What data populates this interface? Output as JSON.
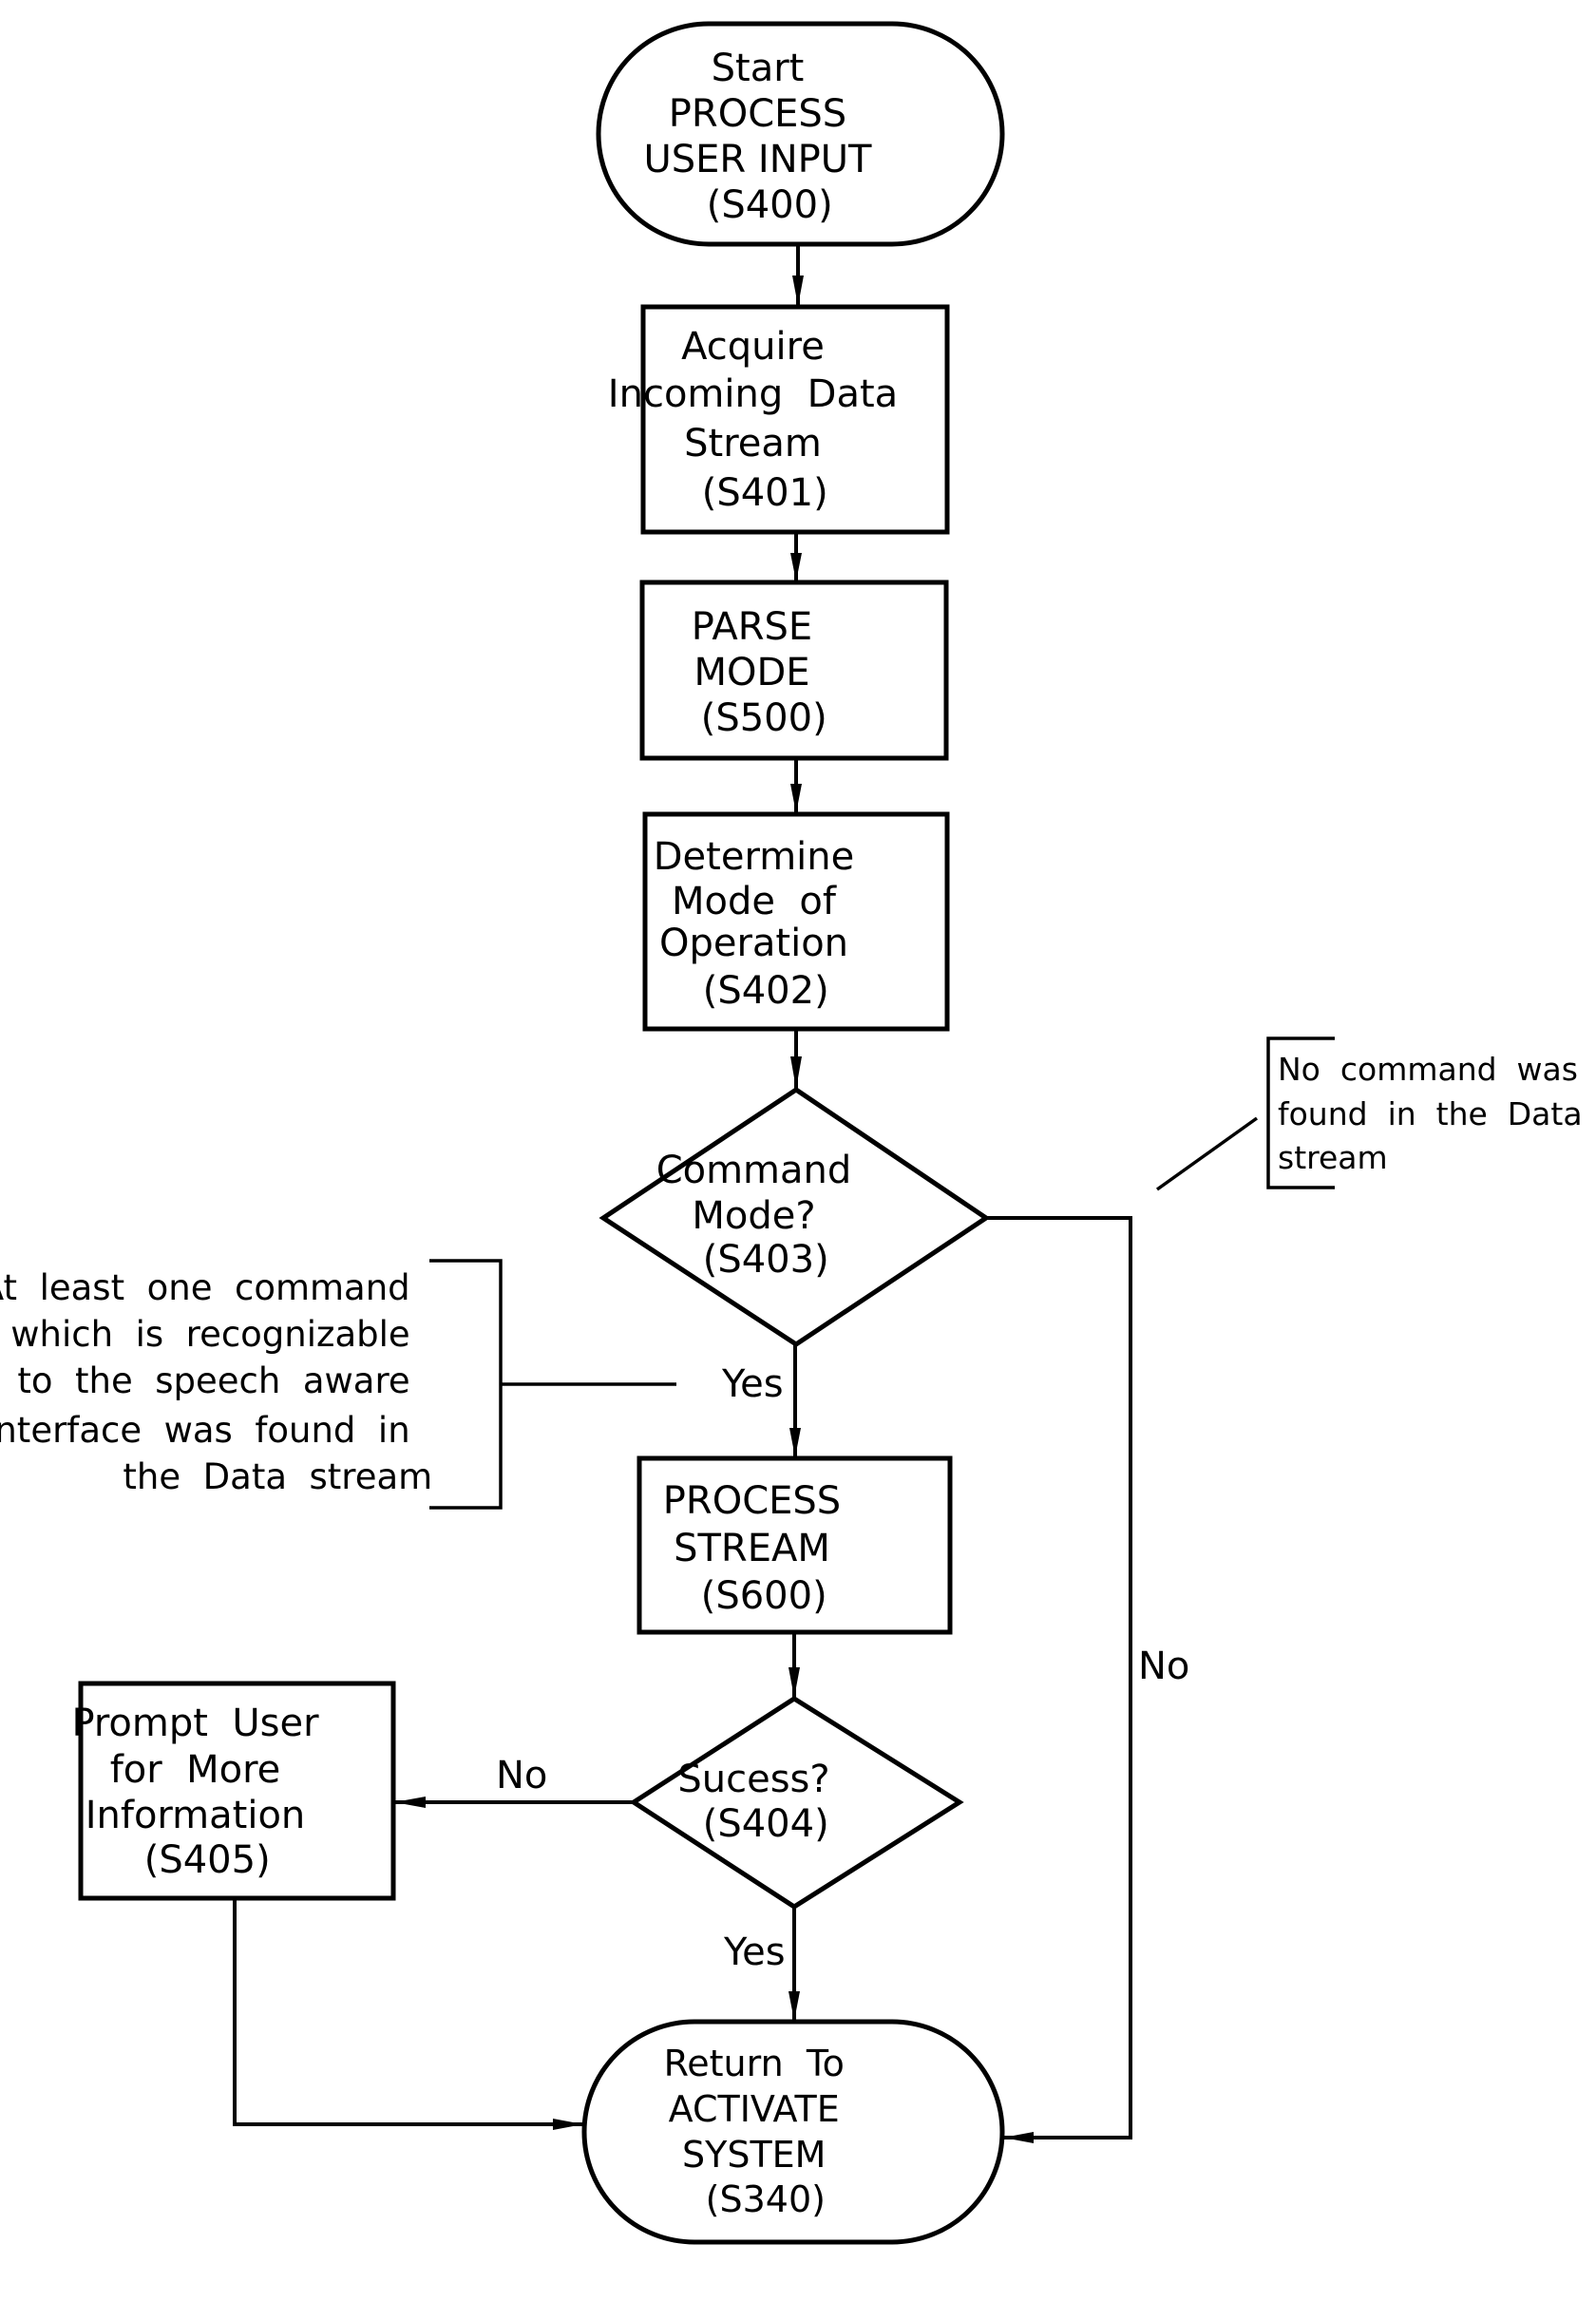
{
  "figure": {
    "type": "flowchart",
    "colors": {
      "stroke": "#000000",
      "background": "#ffffff",
      "text": "#000000"
    }
  },
  "nodes": {
    "s400": {
      "id": "S400",
      "shape": "terminal",
      "lines": [
        "Start",
        "PROCESS",
        "USER INPUT",
        "(S400)"
      ]
    },
    "s401": {
      "id": "S401",
      "shape": "process",
      "lines": [
        "Acquire",
        "Incoming  Data",
        "Stream",
        "(S401)"
      ]
    },
    "s500": {
      "id": "S500",
      "shape": "process",
      "lines": [
        "PARSE",
        "MODE",
        "(S500)"
      ]
    },
    "s402": {
      "id": "S402",
      "shape": "process",
      "lines": [
        "Determine",
        "Mode  of",
        "Operation",
        "(S402)"
      ]
    },
    "s403": {
      "id": "S403",
      "shape": "decision",
      "lines": [
        "Command",
        "Mode?",
        "(S403)"
      ]
    },
    "s600": {
      "id": "S600",
      "shape": "process",
      "lines": [
        "PROCESS",
        "STREAM",
        "(S600)"
      ]
    },
    "s404": {
      "id": "S404",
      "shape": "decision",
      "lines": [
        "Sucess?",
        "(S404)"
      ]
    },
    "s405": {
      "id": "S405",
      "shape": "process",
      "lines": [
        "Prompt  User",
        "for  More",
        "Information",
        "(S405)"
      ]
    },
    "s340": {
      "id": "S340",
      "shape": "terminal",
      "lines": [
        "Return  To",
        "ACTIVATE",
        "SYSTEM",
        "(S340)"
      ]
    }
  },
  "edges": [
    {
      "from": "S400",
      "to": "S401",
      "label": ""
    },
    {
      "from": "S401",
      "to": "S500",
      "label": ""
    },
    {
      "from": "S500",
      "to": "S402",
      "label": ""
    },
    {
      "from": "S402",
      "to": "S403",
      "label": ""
    },
    {
      "from": "S403",
      "to": "S600",
      "label": "Yes"
    },
    {
      "from": "S403",
      "to": "S340",
      "label": "No"
    },
    {
      "from": "S600",
      "to": "S404",
      "label": ""
    },
    {
      "from": "S404",
      "to": "S405",
      "label": "No"
    },
    {
      "from": "S404",
      "to": "S340",
      "label": "Yes"
    },
    {
      "from": "S405",
      "to": "S340",
      "label": ""
    }
  ],
  "edge_labels": {
    "s403_yes": "Yes",
    "s403_no": "No",
    "s404_no": "No",
    "s404_yes": "Yes"
  },
  "annotations": {
    "yes_note": {
      "attached_to": "S403 Yes",
      "lines": [
        "At  least  one  command",
        "which  is  recognizable",
        "to  the  speech  aware",
        "interface  was  found  in",
        "the  Data  stream"
      ]
    },
    "no_note": {
      "attached_to": "S403 No",
      "lines": [
        "No  command  was",
        "found  in  the  Data",
        "stream"
      ]
    }
  }
}
